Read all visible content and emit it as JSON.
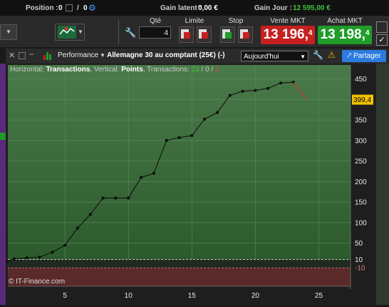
{
  "topbar": {
    "position_label": "Position :",
    "position_value": "0",
    "position_sep": "/",
    "position_value2": "0",
    "latent_label": "Gain latent :",
    "latent_value": "0,00 €",
    "day_label": "Gain Jour :",
    "day_value": "12 595,00 €"
  },
  "order": {
    "qty_label": "Qté",
    "qty_value": "4",
    "limit_label": "Limite",
    "stop_label": "Stop",
    "sell_label": "Vente MKT",
    "sell_price": "13 196,",
    "sell_price_sup": "4",
    "buy_label": "Achat MKT",
    "buy_price": "13 198,",
    "buy_price_sup": "4",
    "accent_sell": "#c62020",
    "accent_buy": "#1f9c2a"
  },
  "window": {
    "tab_label": "Performance",
    "instrument": "Allemagne 30 au comptant (25€) (-)",
    "period": "Aujourd'hui",
    "share_label": "Partager",
    "warning_icon": "warning-icon",
    "settings_icon": "wrench-icon"
  },
  "chart_info": {
    "horizontal_label": "Horizontal:",
    "horizontal_value": "Transactions",
    "vertical_label": "Vertical:",
    "vertical_value": "Points",
    "transactions_label": "Transactions:",
    "wins": "23",
    "neutral": "0",
    "losses": "1"
  },
  "copyright": "© IT-Finance.com",
  "chart_data": {
    "type": "line",
    "title": "",
    "xlabel": "",
    "ylabel": "",
    "x_ticks": [
      5,
      10,
      15,
      20,
      25
    ],
    "y_ticks": [
      450,
      400,
      350,
      300,
      250,
      200,
      150,
      100,
      50,
      10,
      -10
    ],
    "xlim": [
      0.5,
      27.5
    ],
    "ylim": [
      -55,
      470
    ],
    "last_value_label": "399,4",
    "series": [
      {
        "x": [
          0,
          1,
          2,
          3,
          4,
          5,
          6,
          7,
          8,
          9,
          10,
          11,
          12,
          13,
          14,
          15,
          16,
          17,
          18,
          19,
          20,
          21,
          22,
          23
        ],
        "values": [
          0,
          12,
          14,
          16,
          28,
          45,
          87,
          120,
          160,
          160,
          160,
          210,
          220,
          300,
          307,
          312,
          352,
          368,
          410,
          420,
          422,
          427,
          440,
          442
        ],
        "color": "#0a0a0a"
      },
      {
        "x": [
          23,
          24
        ],
        "values": [
          442,
          399.4
        ],
        "color": "#e03030"
      }
    ],
    "bands": {
      "upper": 10,
      "lower": -10,
      "positive_color": "#2b5a2b",
      "negative_color": "#5a2a2a"
    }
  }
}
